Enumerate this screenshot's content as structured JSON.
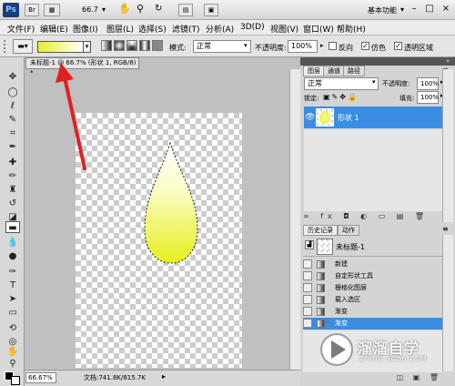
{
  "titlebar": {
    "ps": "Ps",
    "br": "Br",
    "zoom": "66.7",
    "workspace": "基本功能",
    "min": "–",
    "max": "□",
    "close": "×"
  },
  "menu": [
    "文件(F)",
    "编辑(E)",
    "图像(I)",
    "图层(L)",
    "选择(S)",
    "滤镜(T)",
    "分析(A)",
    "3D(D)",
    "视图(V)",
    "窗口(W)",
    "帮助(H)"
  ],
  "options": {
    "mode_label": "模式:",
    "mode_value": "正常",
    "opacity_label": "不透明度:",
    "opacity_value": "100%",
    "reverse": "反向",
    "dither": "仿色",
    "transparency": "透明区域"
  },
  "document": {
    "tab": "未标题-1 @ 66.7% (形状 1, RGB/8) *",
    "zoom": "66.67%",
    "docinfo": "文档:741.8K/815.7K"
  },
  "layers_panel": {
    "tabs": [
      "图层",
      "通道",
      "路径"
    ],
    "blend": "正常",
    "opacity_label": "不透明度:",
    "opacity_value": "100%",
    "lock_label": "锁定:",
    "fill_label": "填充:",
    "fill_value": "100%",
    "layer_name": "形状 1"
  },
  "history_panel": {
    "tabs": [
      "历史记录",
      "动作"
    ],
    "snapshot": "未标题-1",
    "steps": [
      "新建",
      "自定形状工具",
      "栅格化图层",
      "载入选区",
      "渐变",
      "渐变"
    ]
  },
  "watermark": {
    "brand": "溜溜自学",
    "url": "ZIXUE.3D66.COM"
  },
  "colors": {
    "selection": "#3a8de0",
    "drop_top": "#ffffff",
    "drop_bottom": "#e8f02a",
    "arrow": "#e02020"
  }
}
